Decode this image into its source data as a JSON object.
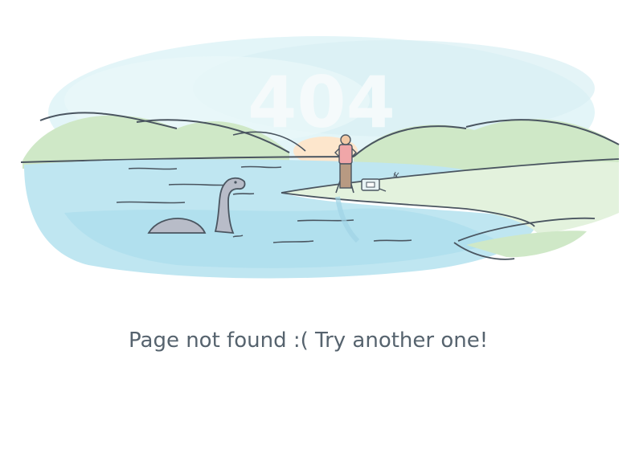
{
  "illustration": {
    "big_number": "404",
    "scene_description_icon": "loch-ness-monster-scene-icon"
  },
  "message": {
    "text": "Page not found :( Try another one!"
  },
  "colors": {
    "water": "#bfe6f1",
    "hills": "#cfe9c9",
    "sky_wash": "#dff3f6",
    "text": "#56636e",
    "sun": "#fde6cc",
    "monster": "#b8bcc8"
  }
}
